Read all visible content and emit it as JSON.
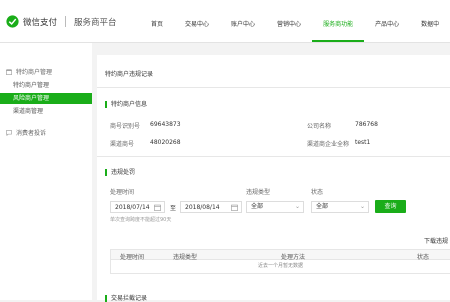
{
  "header": {
    "brand": "微信支付",
    "platform": "服务商平台",
    "nav": [
      {
        "label": "首页"
      },
      {
        "label": "交易中心"
      },
      {
        "label": "账户中心"
      },
      {
        "label": "营销中心"
      },
      {
        "label": "服务商功能"
      },
      {
        "label": "产品中心"
      },
      {
        "label": "数据中"
      }
    ]
  },
  "sidebar": {
    "group1": "特约商户管理",
    "items": [
      {
        "label": "特约商户管理"
      },
      {
        "label": "风险商户管理"
      },
      {
        "label": "渠道商管理"
      }
    ],
    "group2": "消费者投诉"
  },
  "main": {
    "title": "特约商户违规记录",
    "merchant_section": "特约商户信息",
    "merchant_id_label": "商号识别号",
    "merchant_id": "69643873",
    "company_label": "公司名称",
    "company": "786768",
    "channel_id_label": "渠道商号",
    "channel_id": "48020268",
    "channel_name_label": "渠道商企业全称",
    "channel_name": "test1",
    "violation_section": "违规处罚",
    "time_label": "处理时间",
    "date_from": "2018/07/14",
    "date_sep": "至",
    "date_to": "2018/08/14",
    "type_label": "违规类型",
    "type_value": "全部",
    "status_label": "状态",
    "status_value": "全部",
    "query_button": "查询",
    "hint": "单次查询跨度不能超过90天",
    "download_link": "下载违规",
    "table_headers": [
      "处理时间",
      "违规类型",
      "处理方法",
      "状态"
    ],
    "empty_text": "近去一个月暂无数据",
    "section3": "交易拦截记录"
  },
  "colors": {
    "accent": "#1aad19"
  }
}
